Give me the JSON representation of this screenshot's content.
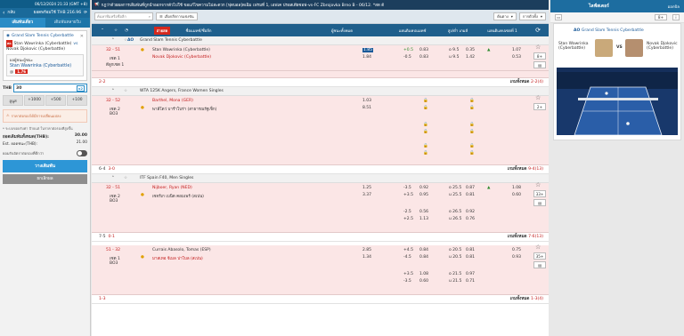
{
  "header": {
    "datetime": "06/12/2024 21:33 (GMT +8)",
    "back_label": "กลับ",
    "balance_label": "ยอดพร้อมใช้ THB 216.96"
  },
  "tabs": {
    "betslip": "เดิมพันเดี่ยว",
    "parlay": "เดิมพันหลายใบ"
  },
  "slip": {
    "league": "Grand Slam Tennis Cyberbattle",
    "live_badge": "สด",
    "teams_1": "Stan Wawrinka (Cyberbattle)",
    "vs": "vs",
    "teams_2": "Novak Djokovic (Cyberbattle)",
    "market": "ผลผู้ชนะผู้ชนะ",
    "pick": "Stan Wawrinka (Cyberbattle)",
    "at_label": "@",
    "odds": "1.76",
    "stake_label": "THB",
    "stake_value": "30",
    "x2": "x2",
    "quick_auto": "อูนูส",
    "quick1": "+1000",
    "quick2": "+500",
    "quick3": "+100",
    "warn": "ราคาต่อรองได้มีการเปลี่ยนแปลง",
    "min_max": "* ระบบขอบรับค่า ป้ายแต่ ในราคาต่อรองที่สูงขึ้น",
    "total_stake_label": "ยอดเดิมพันทั้งหมด(THB):",
    "total_stake": "30.00",
    "est_win_label": "Est. ยอดชนะ(THB):",
    "est_win": "21.00",
    "accept_label": "ยอมรับอัตราต่อรองที่ดีกว่า",
    "place": "วางเดิมพัน",
    "cancel": "ยกเลิกผล"
  },
  "ticker": {
    "text": "กฎว่าด้วยผลการเดิมพันที่ถูกนำออกจากตัวไปใช้ ขอแก้ไขความไม่สะดวก [ฟุตบอล]ดเฉิม เฟรมที่ 1, เอฟเค ปรอสเตียซอฟ-vs-FC Zbrojovka Brno B - 06/12. *สด ด้"
  },
  "filter": {
    "search_placeholder": "ค้นหาทีมหรือชื่อลีก",
    "fav_button": "เลือกลีกการแข่งขัน",
    "sort_select": "ต้นตาง",
    "bettype_select": "การตัวทั้ง"
  },
  "table_header": {
    "live": "ถ่ายสด",
    "match": "ชื่อแมทช์/ชื่อลีก",
    "winner": "ผู้ชนะทั้งหมด",
    "handicap": "แฮนดิแคปแมทช์",
    "over_under": "สูง/ต่ำ เกมส์",
    "set_handicap": "แฮนดิแคปเซตที่ 1"
  },
  "leagues": [
    {
      "name": "Grand Slam Tennis Cyberbattle",
      "icon": "AO",
      "matches": [
        {
          "score": "32 - 51",
          "set": "เซต 1",
          "serve": "ตีลูกเซต 1",
          "p1": "Stan Wawrinka (Cyberbattle)",
          "p2": "Novak Djokovic (Cyberbattle)",
          "w1": "1.85",
          "w2": "1.84",
          "h1": "+0.5",
          "h1o": "0.83",
          "h2": "-0.5",
          "h2o": "0.83",
          "ou1": "o 9.5",
          "ou1o": "0.35",
          "ou2": "u 9.5",
          "ou2o": "1.42",
          "s1": "1.07",
          "s2": "0.53",
          "more": "8+"
        }
      ],
      "foot_score": "2-2",
      "foot_all": "เกมทั้งหมด ",
      "foot_count": "2-2(4)"
    },
    {
      "name": "WTA 125K Angers, France Women Singles",
      "icon": "",
      "matches": [
        {
          "score": "32 - 52",
          "set": "เซต 2",
          "serve": "BO3",
          "p1": "Barthel, Mona (GER)",
          "p2": "พาลีโตว่ บารำโบร่า (สาธารณรัฐเช็ก)",
          "w1": "1.03",
          "w2": "8.51",
          "more": "2+"
        }
      ],
      "foot_score": "6-4",
      "foot_score2": "3-0",
      "foot_all": "เกมทั้งหมด ",
      "foot_count": "9-4(13)"
    },
    {
      "name": "ITF Spain F40, Men Singles",
      "icon": "",
      "matches": [
        {
          "score": "32 - 51",
          "set": "เซต 2",
          "serve": "BO3",
          "p1": "Nijboer, Ryan (NED)",
          "p2": "เซจร์เก เบนิต คอมเพร์ (สเปน)",
          "w1": "1.25",
          "w2": "3.37",
          "h1": "-3.5",
          "h1o": "0.92",
          "h2": "+3.5",
          "h2o": "0.95",
          "ou1": "o 25.5",
          "ou1o": "0.87",
          "ou2": "u 25.5",
          "ou2o": "0.81",
          "s1": "1.08",
          "s2": "0.60",
          "more": "33+",
          "extra": [
            {
              "h1": "-2.5",
              "h1o": "0.56",
              "ou1": "o 26.5",
              "ou1o": "0.92"
            },
            {
              "h1": "+2.5",
              "h1o": "1.13",
              "ou1": "u 26.5",
              "ou1o": "0.76"
            }
          ]
        }
      ],
      "foot_score": "7-5",
      "foot_score2": "0-1",
      "foot_all": "เกมทั้งหมด ",
      "foot_count": "7-6(13)"
    },
    {
      "name": "",
      "icon": "",
      "matches": [
        {
          "score": "51 - 32",
          "set": "เซต 1",
          "serve": "BO3",
          "p1": "Currais Abasolo, Tomas (ESP)",
          "p2": "มาสเทอ จีเมล ปาโบล (สเปน)",
          "w1": "2.85",
          "w2": "1.34",
          "h1": "+4.5",
          "h1o": "0.84",
          "h2": "-4.5",
          "h2o": "0.84",
          "ou1": "o 20.5",
          "ou1o": "0.81",
          "ou2": "u 20.5",
          "ou2o": "0.81",
          "s1": "0.75",
          "s2": "0.93",
          "more": "35+",
          "extra": [
            {
              "h1": "+3.5",
              "h1o": "1.08",
              "ou1": "o 21.5",
              "ou1o": "0.97"
            },
            {
              "h1": "-3.5",
              "h1o": "0.60",
              "ou1": "u 21.5",
              "ou1o": "0.71"
            }
          ]
        }
      ],
      "foot_score": "1-3",
      "foot_all": "เกมทั้งหมด ",
      "foot_count": "1-3(4)"
    }
  ],
  "right": {
    "title": "ไลฟ์สเตอร์",
    "close_label": "ออกบิล",
    "plus": "8+",
    "league": "Grand Slam Tennis Cyberbattle",
    "p1": "Stan Wawrinka (Cyberbattle)",
    "p2": "Novak Djokovic (Cyberbattle)",
    "vs": "VS"
  }
}
